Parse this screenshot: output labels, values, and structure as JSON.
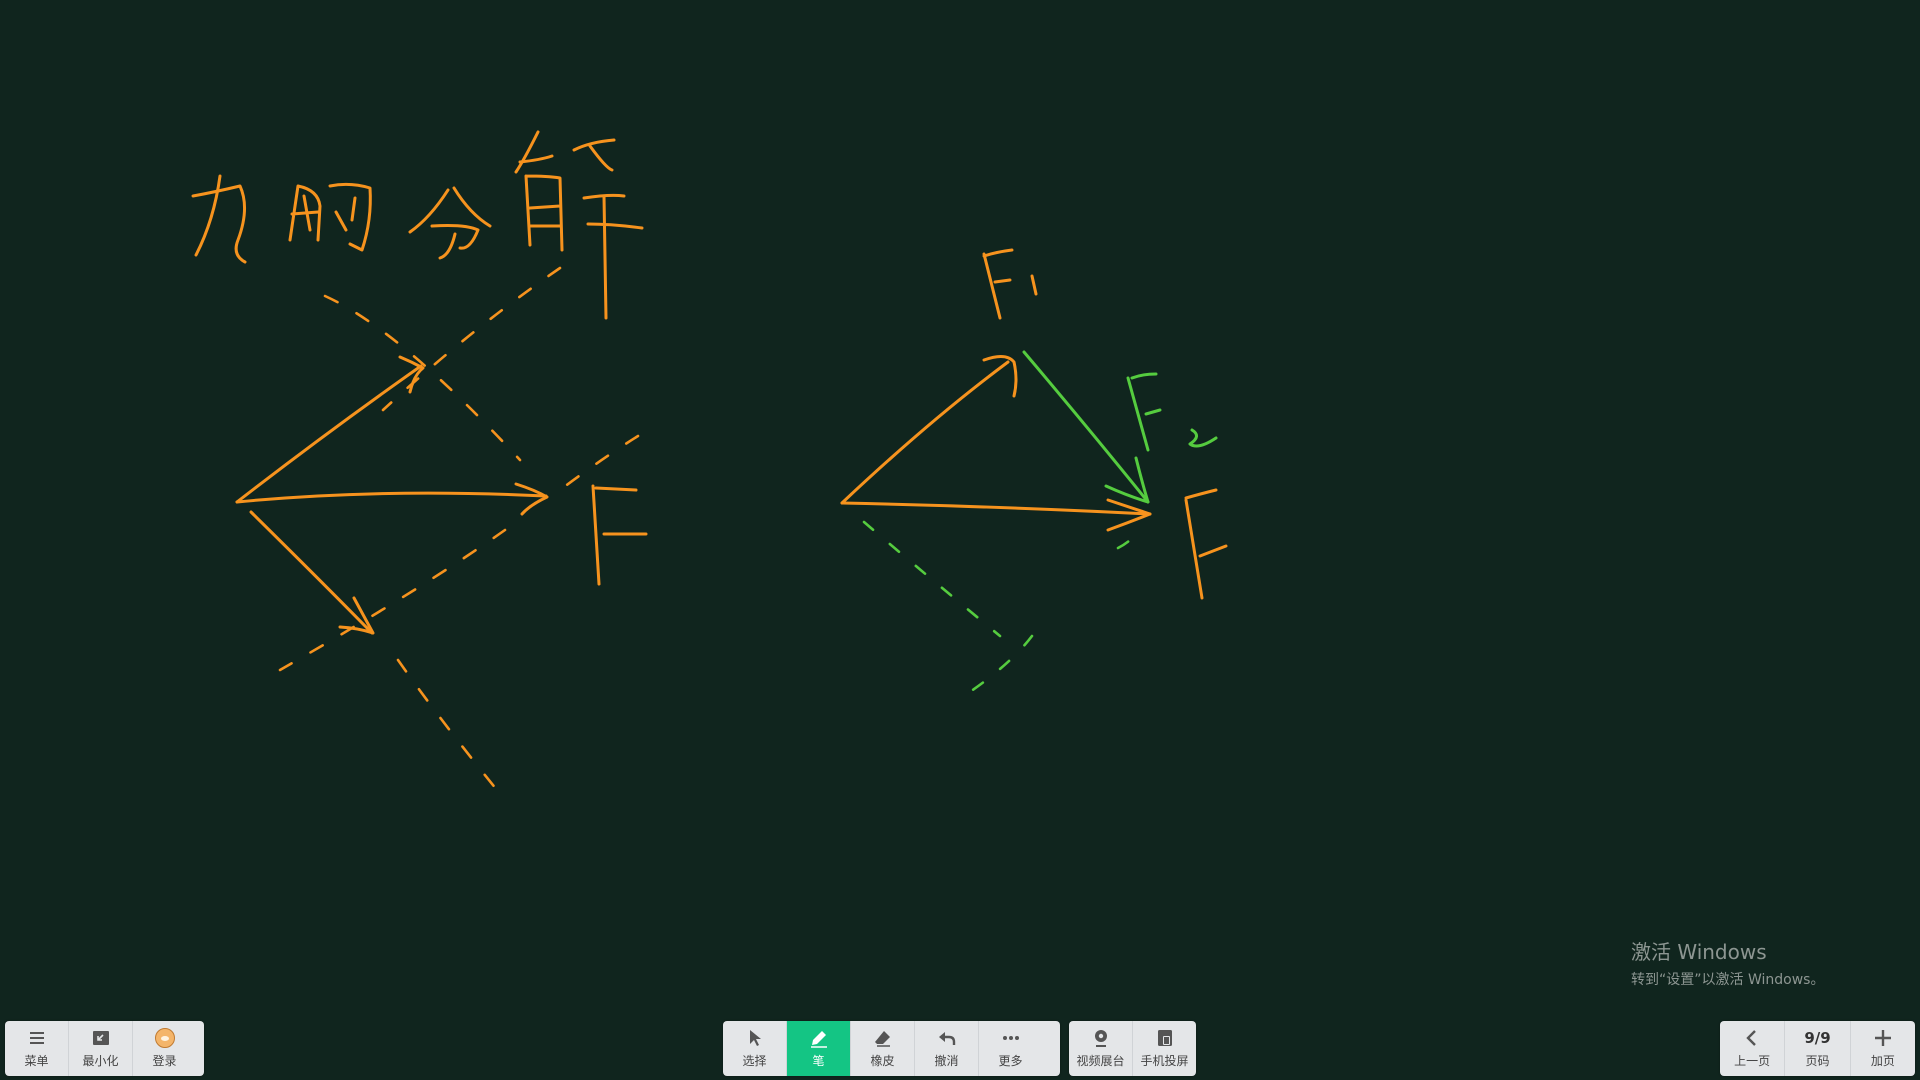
{
  "board": {
    "background": "#10251e",
    "ink_colors": {
      "orange": "#f6931e",
      "green": "#55cc3f"
    }
  },
  "watermark": {
    "title": "激活 Windows",
    "subtitle": "转到“设置”以激活 Windows。"
  },
  "toolbar_left": {
    "menu_label": "菜单",
    "minimize_label": "最小化",
    "login_label": "登录"
  },
  "toolbar_center": {
    "select_label": "选择",
    "pen_label": "笔",
    "eraser_label": "橡皮",
    "undo_label": "撤消",
    "more_label": "更多",
    "active_tool": "笔",
    "active_color": "#14c584"
  },
  "toolbar_media": {
    "video_booth_label": "视频展台",
    "phone_cast_label": "手机投屏"
  },
  "toolbar_right": {
    "prev_label": "上一页",
    "page_value": "9/9",
    "page_label": "页码",
    "add_label": "加页"
  },
  "icons": [
    "menu-icon",
    "minimize-icon",
    "avatar-icon",
    "cursor-icon",
    "pen-icon",
    "eraser-icon",
    "undo-icon",
    "more-icon",
    "camera-icon",
    "phone-cast-icon",
    "chevron-left-icon",
    "plus-icon"
  ]
}
